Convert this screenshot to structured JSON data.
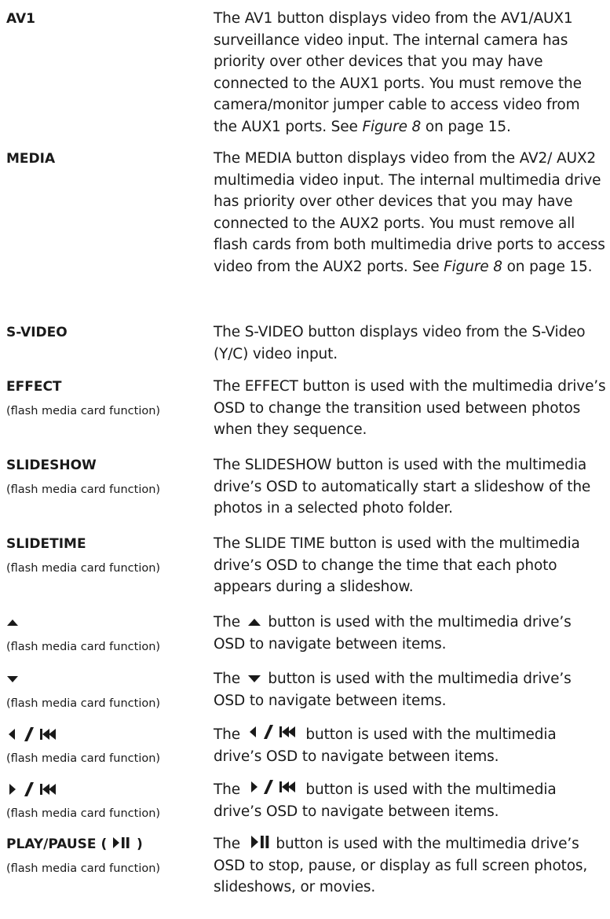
{
  "entries": [
    {
      "term": "AV1",
      "sub": "",
      "desc_before": "The AV1 button displays video from the AV1/AUX1 surveillance video input. The internal camera has priority over other devices that you may have connected to the AUX1 ports. You must remove the camera/monitor jumper cable to access video from the AUX1 ports. See ",
      "desc_italic": "Figure 8",
      "desc_after": " on page 15."
    },
    {
      "term": "MEDIA",
      "sub": "",
      "desc_before": "The MEDIA button displays video from the AV2/ AUX2 multimedia video input. The internal multimedia drive has priority over other devices that you may have connected to the AUX2 ports. You must remove all flash cards from both multimedia drive ports to access video from the AUX2 ports. See ",
      "desc_italic": "Figure 8",
      "desc_after": " on page 15."
    },
    {
      "term": "S-VIDEO",
      "sub": "",
      "desc": "The S-VIDEO button displays video from the S-Video (Y/C) video input."
    },
    {
      "term": "EFFECT",
      "sub": "(flash media card function)",
      "desc": "The EFFECT button is used with the multimedia drive’s OSD to change the transition used between photos when they sequence."
    },
    {
      "term": "SLIDESHOW",
      "sub": "(flash media card function)",
      "desc": "The SLIDESHOW button is used with the multimedia drive’s OSD to automatically start a slideshow of the photos in a selected photo folder."
    },
    {
      "term": "SLIDETIME",
      "sub": "(flash media card function)",
      "desc": "The SLIDE TIME button is used with the multimedia drive’s OSD to change the time that each photo appears during a slideshow."
    },
    {
      "term_icon": "up-triangle-icon",
      "sub": "(flash media card function)",
      "desc_before": "The ",
      "desc_after": " button is used with the multimedia drive’s OSD to navigate between items."
    },
    {
      "term_icon": "down-triangle-icon",
      "sub": "(flash media card function)",
      "desc_before": "The ",
      "desc_after": " button is used with the multimedia drive’s OSD to navigate between items."
    },
    {
      "term_icon": "left-arrow-slash-previous-icon",
      "sub": "(flash media card function)",
      "desc_before": "The ",
      "desc_after": " button is used with the multimedia drive’s OSD to navigate between items."
    },
    {
      "term_icon": "right-arrow-slash-previous-icon",
      "sub": "(flash media card function)",
      "desc_before": "The ",
      "desc_after": " button is used with the multimedia drive’s OSD to navigate between items."
    },
    {
      "term": "PLAY/PAUSE ( ",
      "term_after": " )",
      "term_icon": "play-pause-icon",
      "sub": "(flash media card function)",
      "desc_before": "The ",
      "desc_after": " button is used with the multimedia drive’s OSD to stop, pause, or display as full screen photos, slideshows, or movies."
    }
  ]
}
